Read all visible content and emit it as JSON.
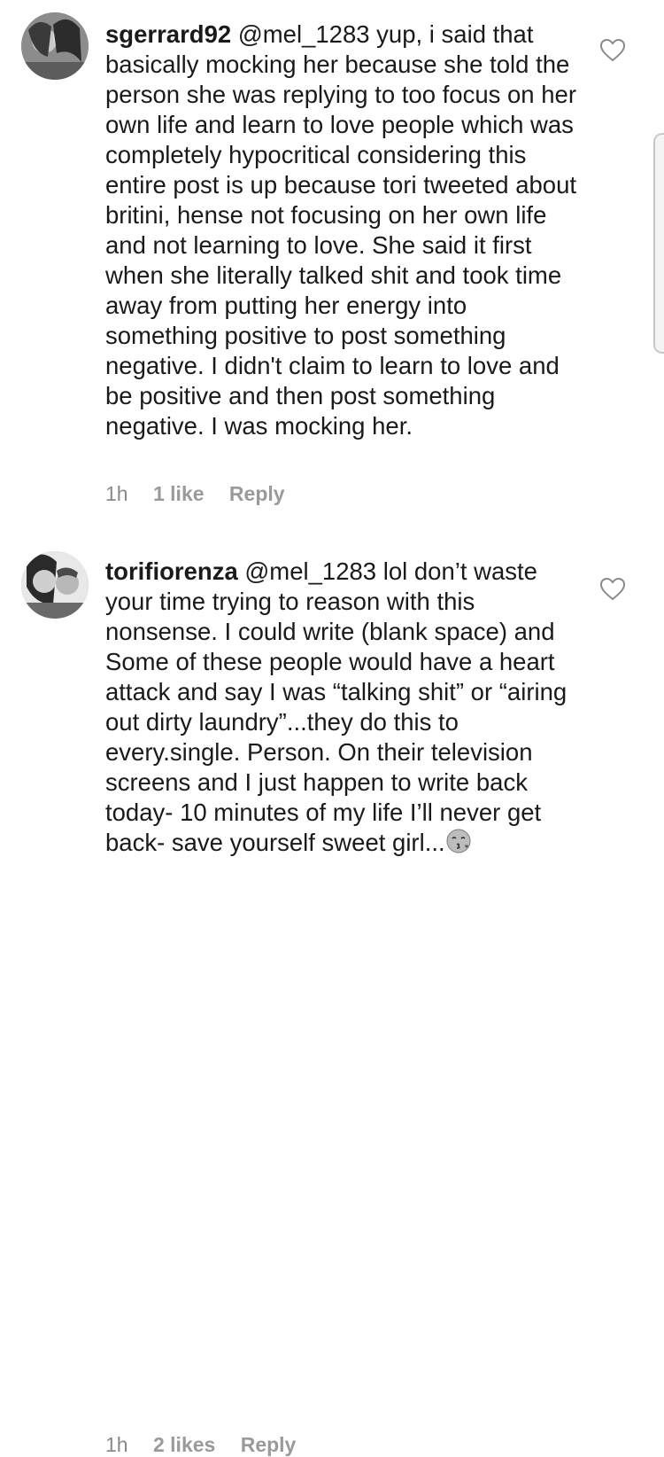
{
  "comments": [
    {
      "username": "sgerrard92",
      "text": "@mel_1283 yup, i said that basically mocking her because she told the person she was replying to too focus on her own life and learn to love people which was completely hypocritical considering this entire post is up because tori tweeted about britini, hense not focusing on her own life and not learning to love.  She said it first when she literally talked shit and took time away from putting her energy into something positive to post something negative.  I didn't claim to learn to love and be positive and then post something negative. I was mocking her.",
      "time": "1h",
      "likes": "1 like",
      "reply": "Reply",
      "avatar_icon": "profile-photo"
    },
    {
      "username": "torifiorenza",
      "text": "@mel_1283 lol don’t waste your time trying to reason with this nonsense. I could write (blank space) and Some of these people would have a heart attack and say I was “talking shit” or “airing out dirty laundry”...they do this to every.single. Person. On their television screens and I just happen to write back today- 10 minutes of my life I’ll never get back- save yourself sweet girl...",
      "emoji_icon": "kissing-face-emoji",
      "time": "1h",
      "likes": "2 likes",
      "reply": "Reply",
      "avatar_icon": "profile-photo"
    }
  ],
  "colors": {
    "text": "#1a1a1a",
    "meta": "#8a8a8a",
    "background": "#ffffff"
  }
}
